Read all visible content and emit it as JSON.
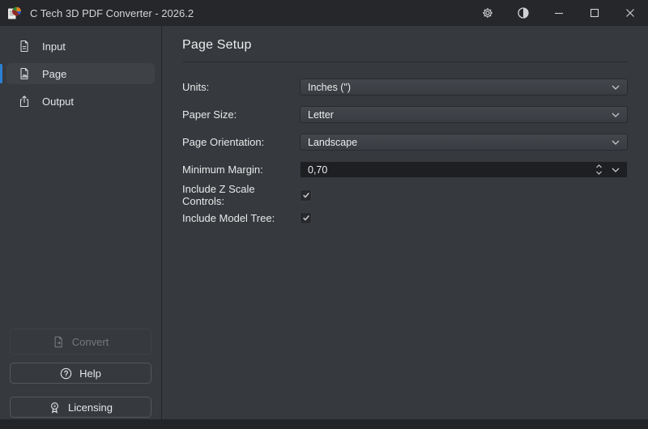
{
  "window": {
    "title": "C Tech 3D PDF Converter - 2026.2"
  },
  "titlebar": {
    "icons": [
      "gear-icon",
      "contrast-icon",
      "minimize-icon",
      "maximize-icon",
      "close-icon"
    ]
  },
  "sidebar": {
    "items": [
      {
        "label": "Input",
        "icon": "document-lines-icon",
        "selected": false
      },
      {
        "label": "Page",
        "icon": "document-image-icon",
        "selected": true
      },
      {
        "label": "Output",
        "icon": "export-icon",
        "selected": false
      }
    ],
    "buttons": [
      {
        "label": "Convert",
        "icon": "convert-file-icon",
        "disabled": true
      },
      {
        "label": "Help",
        "icon": "help-circle-icon",
        "disabled": false
      },
      {
        "label": "Licensing",
        "icon": "license-badge-icon",
        "disabled": false
      }
    ]
  },
  "main": {
    "heading": "Page Setup",
    "fields": [
      {
        "label": "Units:",
        "type": "select",
        "value": "Inches (\")"
      },
      {
        "label": "Paper Size:",
        "type": "select",
        "value": "Letter"
      },
      {
        "label": "Page Orientation:",
        "type": "select",
        "value": "Landscape"
      },
      {
        "label": "Minimum Margin:",
        "type": "spinbox",
        "value": "0,70"
      },
      {
        "label": "Include Z Scale Controls:",
        "type": "checkbox",
        "checked": true
      },
      {
        "label": "Include Model Tree:",
        "type": "checkbox",
        "checked": true
      }
    ]
  },
  "colors": {
    "titlebar": "#25272a",
    "background": "#36393d",
    "sidebar_selected": "#3e4247",
    "accent_blue": "#2b80d4",
    "control_gradient_top": "#43474c",
    "control_gradient_bottom": "#393c41",
    "spinbox_background": "#1d1f22",
    "text": "#e8e9ea",
    "disabled_text": "#75787c"
  }
}
